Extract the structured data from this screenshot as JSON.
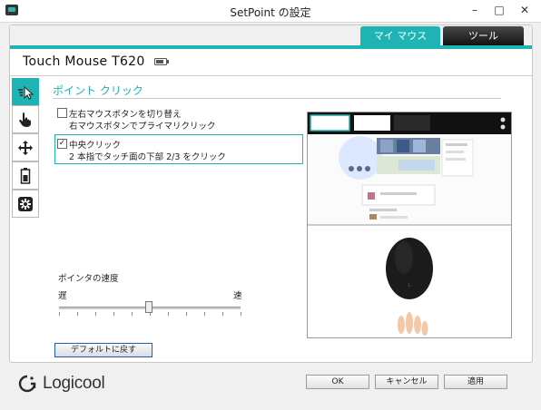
{
  "window": {
    "title": "SetPoint の設定",
    "minimize": "–",
    "maximize": "□",
    "close": "✕"
  },
  "tabs": [
    {
      "label": "マイ マウス",
      "active": true
    },
    {
      "label": "ツール",
      "active": false
    }
  ],
  "device": {
    "name": "Touch Mouse T620"
  },
  "sidebar": {
    "items": [
      {
        "icon": "pointer-speed-icon",
        "active": true
      },
      {
        "icon": "hand-touch-icon",
        "active": false
      },
      {
        "icon": "move-arrows-icon",
        "active": false
      },
      {
        "icon": "battery-icon",
        "active": false
      },
      {
        "icon": "unifying-receiver-icon",
        "active": false
      }
    ]
  },
  "section": {
    "title": "ポイント クリック"
  },
  "options": [
    {
      "label": "左右マウスボタンを切り替え",
      "desc": "右マウスボタンでプライマリクリック",
      "checked": false
    },
    {
      "label": "中央クリック",
      "desc": "2 本指でタッチ面の下部 2/3 をクリック",
      "checked": true
    }
  ],
  "speed": {
    "title": "ポインタの速度",
    "slow": "遅",
    "fast": "速",
    "level": 0.5
  },
  "reset_label": "デフォルトに戻す",
  "brand": "Logicool",
  "buttons": {
    "ok": "OK",
    "cancel": "キャンセル",
    "apply": "適用"
  },
  "colors": {
    "accent": "#1eb4b4"
  }
}
